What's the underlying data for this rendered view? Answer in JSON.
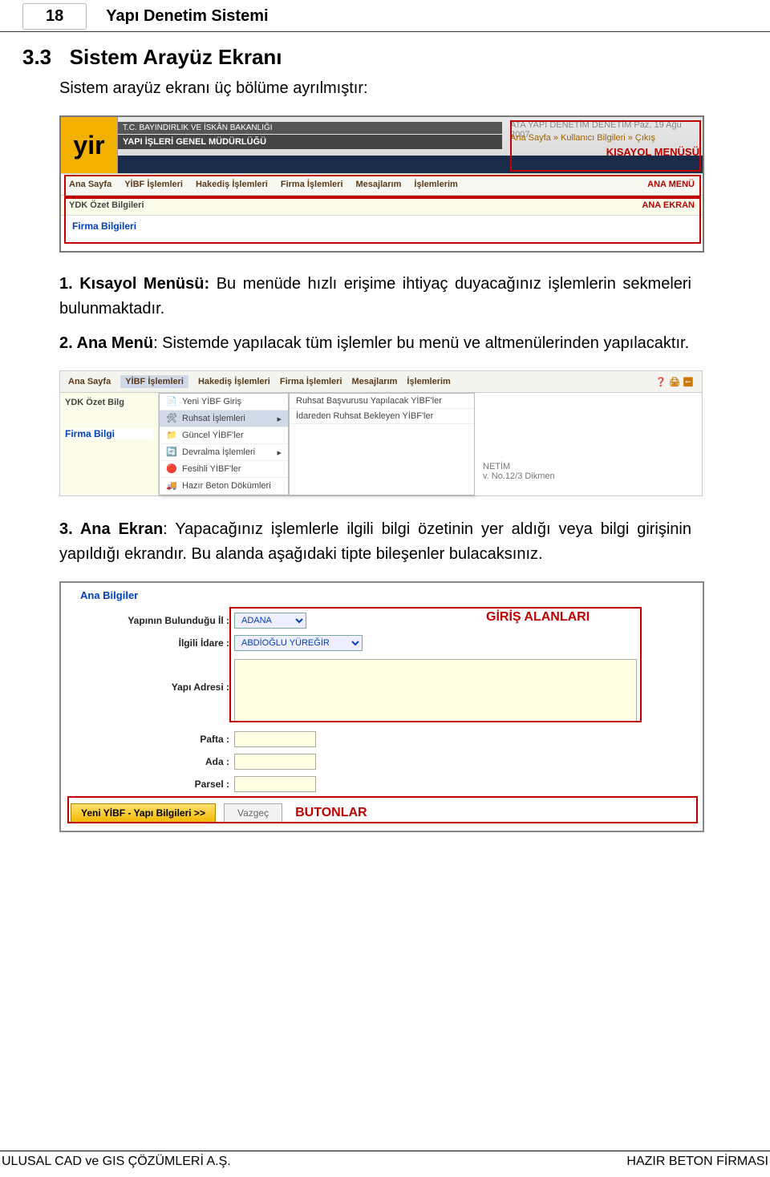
{
  "page_number": "18",
  "doc_title": "Yapı Denetim Sistemi",
  "section": {
    "num": "3.3",
    "title": "Sistem Arayüz Ekranı"
  },
  "intro": "Sistem arayüz ekranı üç bölüme ayrılmıştır:",
  "p1_lead": "1. Kısayol Menüsü:",
  "p1_rest": " Bu menüde hızlı erişime ihtiyaç duyacağınız işlemlerin sekmeleri bulunmaktadır.",
  "p2_lead": "2. Ana Menü",
  "p2_rest": ": Sistemde yapılacak tüm işlemler bu menü ve altmenülerinden yapılacaktır.",
  "p3_lead": "3. Ana Ekran",
  "p3_rest": ": Yapacağınız işlemlerle ilgili bilgi özetinin yer aldığı veya bilgi girişinin yapıldığı ekrandır. Bu alanda aşağıdaki tipte bileşenler bulacaksınız.",
  "scr1": {
    "logo": "yir",
    "band1": "T.C. BAYINDIRLIK VE İSKÂN BAKANLIĞI",
    "band2": "YAPI İŞLERİ GENEL MÜDÜRLÜĞÜ",
    "top_right_line1": "ATA YAPI DENETİM DENETİM     Paz, 19 Ağu 2007",
    "top_right_links": "Ana Sayfa  »   Kullanıcı Bilgileri »   Çıkış",
    "top_right_red": "KISAYOL MENÜSÜ",
    "bar": [
      "Ana Sayfa",
      "YİBF İşlemleri",
      "Hakediş İşlemleri",
      "Firma İşlemleri",
      "Mesajlarım",
      "İşlemlerim"
    ],
    "bar_right": "ANA MENÜ",
    "sub_left": "YDK Özet Bilgileri",
    "sub_right": "ANA EKRAN",
    "firma": "Firma Bilgileri"
  },
  "scr2": {
    "bar": [
      "Ana Sayfa",
      "YİBF İşlemleri",
      "Hakediş İşlemleri",
      "Firma İşlemleri",
      "Mesajlarım",
      "İşlemlerim"
    ],
    "left1": "YDK Özet Bilg",
    "firma": "Firma Bilgi",
    "menu": [
      "Yeni YİBF Giriş",
      "Ruhsat İşlemleri",
      "Güncel YİBF'ler",
      "Devralma İşlemleri",
      "Fesihli YİBF'ler",
      "Hazır Beton Dökümleri"
    ],
    "submenu": [
      "Ruhsat Başvurusu Yapılacak YİBF'ler",
      "İdareden Ruhsat Bekleyen YİBF'ler"
    ],
    "rest1": "NETİM",
    "rest2": "v. No.12/3 Dikmen"
  },
  "scr3": {
    "title": "Ana Bilgiler",
    "labels": {
      "il": "Yapının Bulunduğu İl :",
      "idare": "İlgili İdare :",
      "adres": "Yapı Adresi :",
      "pafta": "Pafta :",
      "ada": "Ada :",
      "parsel": "Parsel :"
    },
    "il_val": "ADANA",
    "idare_val": "ABDİOĞLU YÜREĞİR",
    "red1": "GİRİŞ ALANLARI",
    "btn_primary": "Yeni YİBF - Yapı Bilgileri >>",
    "btn_sec": "Vazgeç",
    "red2": "BUTONLAR"
  },
  "footer_left": "ULUSAL CAD ve GIS ÇÖZÜMLERİ A.Ş.",
  "footer_right": "HAZIR BETON FİRMASI"
}
